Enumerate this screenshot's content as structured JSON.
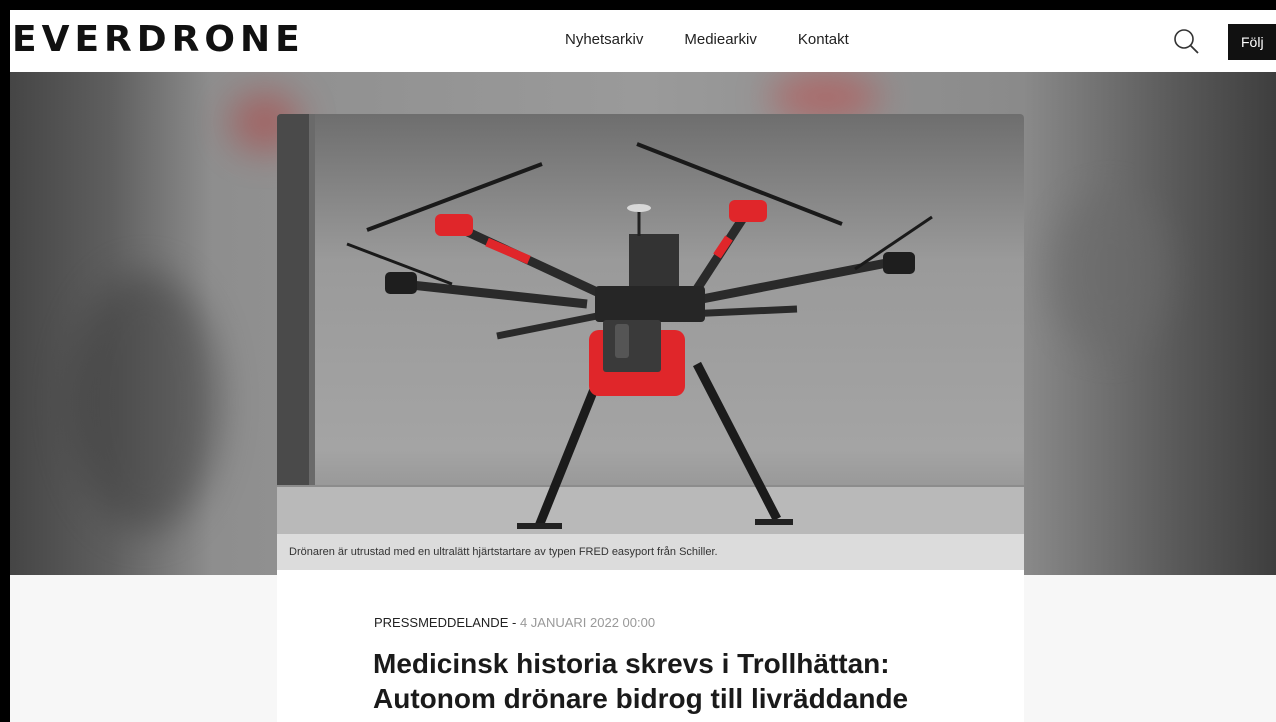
{
  "header": {
    "logo": "EVERDRONE",
    "nav": [
      "Nyhetsarkiv",
      "Mediearkiv",
      "Kontakt"
    ],
    "search_icon": "search-icon",
    "follow_label": "Följ"
  },
  "hero": {
    "caption": "Drönaren är utrustad med en ultralätt hjärtstartare av typen FRED easyport från Schiller."
  },
  "article": {
    "type": "PRESSMEDDELANDE",
    "separator": " - ",
    "date": "4 JANUARI 2022 00:00",
    "title": "Medicinsk historia skrevs i Trollhättan: Autonom drönare bidrog till livräddande"
  },
  "colors": {
    "accent_red": "#e0262a",
    "header_bg": "#ffffff",
    "follow_bg": "#111111"
  }
}
